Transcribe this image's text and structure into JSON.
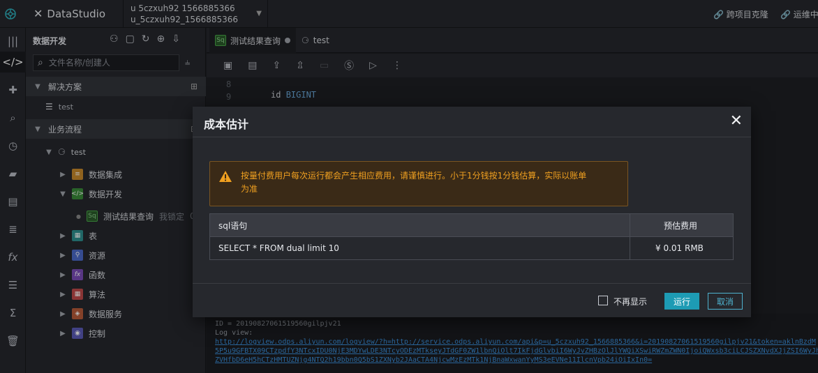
{
  "topbar": {
    "app_name": "DataStudio",
    "project_line1": "u 5czxuh92 1566885366",
    "project_line2": "u_5czxuh92_1566885366",
    "cross_project": "跨项目克隆",
    "ops_center": "运维中"
  },
  "panel": {
    "title": "数据开发",
    "search_placeholder": "文件名称/创建人",
    "section_solution": "解决方案",
    "solution_item": "test",
    "section_workflow": "业务流程",
    "workflow_root": "test",
    "nodes": [
      {
        "label": "数据集成",
        "color": "#c88a2c"
      },
      {
        "label": "数据开发",
        "color": "#3a8a3a"
      },
      {
        "label": "表",
        "color": "#2f8f8f"
      },
      {
        "label": "资源",
        "color": "#4b6ac9"
      },
      {
        "label": "函数",
        "color": "#7a4bb8"
      },
      {
        "label": "算法",
        "color": "#c04a4a"
      },
      {
        "label": "数据服务",
        "color": "#b85a3a"
      },
      {
        "label": "控制",
        "color": "#5a5ab8"
      }
    ],
    "sql_node": "测试结果查询",
    "sql_lock": "我锁定",
    "sql_extra": "08"
  },
  "editor": {
    "tab1": "测试结果查询",
    "tab2": "test",
    "line_numbers": [
      "8",
      "9"
    ],
    "code_line_keyword": "id",
    "code_line_type": "BIGINT",
    "log_id": "ID = 20190827061519560gilpjv21",
    "log_view": "Log view:",
    "log_link1": "http://logview.odps.aliyun.com/logview/?h=http://service.odps.aliyun.com/api&p=u_5czxuh92_1566885366&i=20190827061519560gilpjv21&token=aklnBzdM",
    "log_link2": "5P5u9GFBTX09CTzpdfY3NTcxIDU0NjE3MDYwLDE3NTcyODEzMTkseyJTdGF0ZW1lbnQiOlt7IkFjdGlvbiI6WyJvZHBzOlJlYWQiXSwiRWZmZWN0IjoiQWxsb3ciLCJSZXNvdXJjZSI6WyJh",
    "log_link3": "ZVHfbD6eH5hCTzHMTUZNjg4NTQ2h19bbn0Q5bS1ZXNyb2JAaCTA4NjcwMzEzMTk1NjBnaWxwanYyMS3eEVNe11IlcnVpb24iOiIxIn0="
  },
  "modal": {
    "title": "成本估计",
    "warning": "按量付费用户每次运行都会产生相应费用，请谨慎进行。小于1分钱按1分钱估算，实际以账单为准",
    "col_sql": "sql语句",
    "col_cost": "预估费用",
    "row_sql": "SELECT * FROM dual limit 10",
    "row_cost": "¥ 0.01 RMB",
    "dont_show": "不再显示",
    "run": "运行",
    "cancel": "取消"
  },
  "colors": {
    "accent": "#1d9bb4",
    "warning": "#f0a020"
  }
}
